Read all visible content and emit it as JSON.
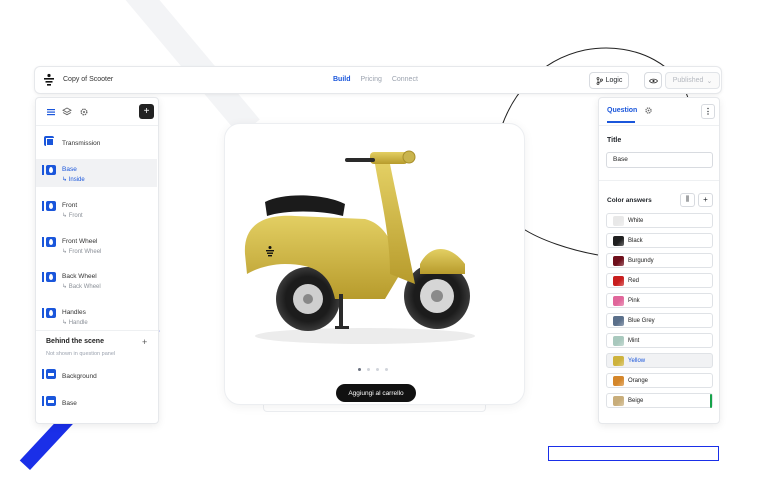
{
  "topbar": {
    "title": "Copy of Scooter",
    "nav": [
      "Build",
      "Pricing",
      "Connect"
    ],
    "active_nav": "Build",
    "logic_label": "Logic",
    "publish_label": "Published"
  },
  "left_panel": {
    "layers": [
      {
        "name": "Transmission",
        "sub": "",
        "icon": "grid-icon"
      },
      {
        "name": "Base",
        "sub": "↳ Inside",
        "icon": "material-icon"
      },
      {
        "name": "Front",
        "sub": "↳ Front",
        "icon": "material-icon"
      },
      {
        "name": "Front Wheel",
        "sub": "↳ Front Wheel",
        "icon": "material-icon"
      },
      {
        "name": "Back Wheel",
        "sub": "↳ Back Wheel",
        "icon": "material-icon"
      },
      {
        "name": "Handles",
        "sub": "↳ Handle",
        "icon": "material-icon"
      }
    ],
    "selected_layer": "Base",
    "scene": {
      "title": "Behind the scene",
      "note": "Not shown in question panel",
      "items": [
        "Background",
        "Base"
      ]
    }
  },
  "preview": {
    "cart_label": "Aggiungi al carrello",
    "carousel_index": 1,
    "carousel_total": 4
  },
  "right_panel": {
    "tab_question": "Question",
    "title_label": "Title",
    "title_value": "Base",
    "color_answers_label": "Color answers",
    "colors": [
      {
        "name": "White",
        "hex": "#e8e8e8"
      },
      {
        "name": "Black",
        "hex": "#1f1f1f"
      },
      {
        "name": "Burgundy",
        "hex": "#6e0f1b"
      },
      {
        "name": "Red",
        "hex": "#c81e1e"
      },
      {
        "name": "Pink",
        "hex": "#e0669a"
      },
      {
        "name": "Blue Grey",
        "hex": "#5a6f8a"
      },
      {
        "name": "Mint",
        "hex": "#a8c8bd"
      },
      {
        "name": "Yellow",
        "hex": "#cdb23c"
      },
      {
        "name": "Orange",
        "hex": "#d4862a"
      },
      {
        "name": "Beige",
        "hex": "#c8ad7a"
      }
    ],
    "selected_color": "Yellow"
  }
}
